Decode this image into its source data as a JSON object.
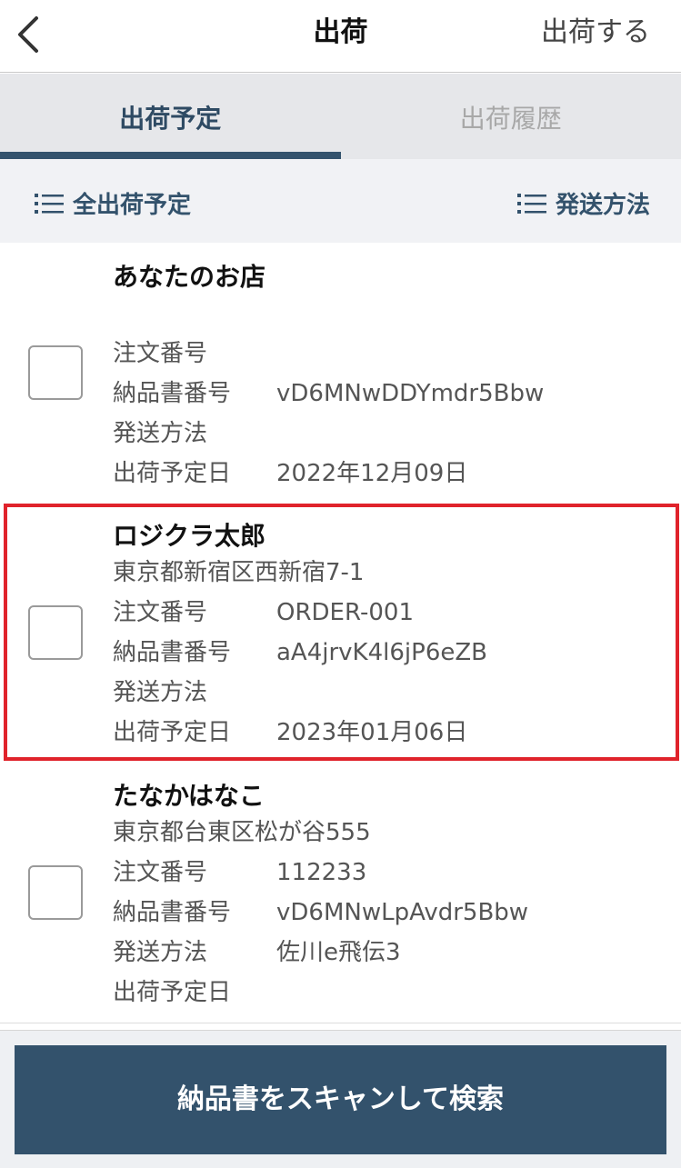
{
  "navbar": {
    "title": "出荷",
    "action_label": "出荷する"
  },
  "tabs": [
    {
      "label": "出荷予定",
      "active": true
    },
    {
      "label": "出荷履歴",
      "active": false
    }
  ],
  "filters": {
    "left_label": "全出荷予定",
    "right_label": "発送方法"
  },
  "labels": {
    "order_no": "注文番号",
    "invoice_no": "納品書番号",
    "shipping_method": "発送方法",
    "ship_date": "出荷予定日"
  },
  "items": [
    {
      "name": "あなたのお店",
      "address": "",
      "order_no": "",
      "invoice_no": "vD6MNwDDYmdr5Bbw",
      "shipping_method": "",
      "ship_date": "2022年12月09日",
      "checked": false
    },
    {
      "name": "ロジクラ太郎",
      "address": "東京都新宿区西新宿7-1",
      "order_no": "ORDER-001",
      "invoice_no": "aA4jrvK4l6jP6eZB",
      "shipping_method": "",
      "ship_date": "2023年01月06日",
      "checked": false,
      "highlighted": true
    },
    {
      "name": "たなかはなこ",
      "address": "東京都台東区松が谷555",
      "order_no": "112233",
      "invoice_no": "vD6MNwLpAvdr5Bbw",
      "shipping_method": "佐川e飛伝3",
      "ship_date": "",
      "checked": false
    }
  ],
  "bottom": {
    "scan_button_label": "納品書をスキャンして検索"
  },
  "colors": {
    "primary": "#33526c",
    "highlight": "#e0232b"
  }
}
